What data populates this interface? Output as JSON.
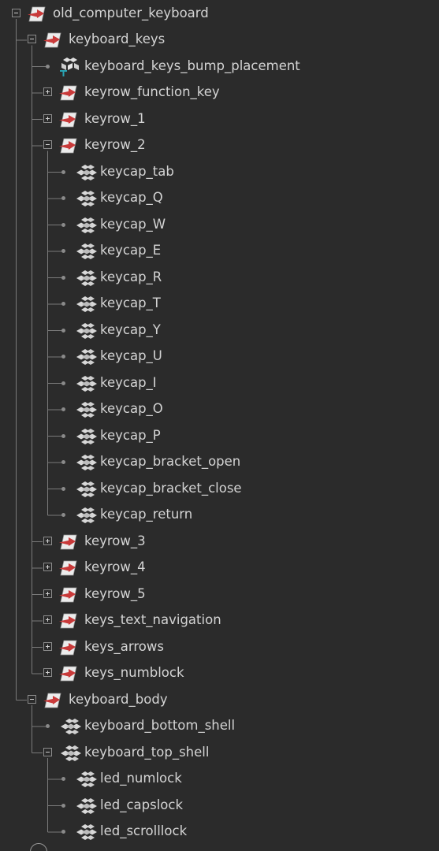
{
  "outliner": {
    "rows": [
      {
        "id": "old_computer_keyboard",
        "depth": 0,
        "state": "expanded",
        "icon": "transform-group-icon",
        "label": "old_computer_keyboard"
      },
      {
        "id": "keyboard_keys",
        "depth": 1,
        "state": "expanded",
        "icon": "transform-group-icon",
        "label": "keyboard_keys"
      },
      {
        "id": "keyboard_keys_bump_placement",
        "depth": 2,
        "state": "leaf",
        "icon": "texture-placement-icon",
        "label": "keyboard_keys_bump_placement"
      },
      {
        "id": "keyrow_function_key",
        "depth": 2,
        "state": "collapsed",
        "icon": "transform-group-icon",
        "label": "keyrow_function_key"
      },
      {
        "id": "keyrow_1",
        "depth": 2,
        "state": "collapsed",
        "icon": "transform-group-icon",
        "label": "keyrow_1"
      },
      {
        "id": "keyrow_2",
        "depth": 2,
        "state": "expanded",
        "icon": "transform-group-icon",
        "label": "keyrow_2"
      },
      {
        "id": "keycap_tab",
        "depth": 3,
        "state": "leaf",
        "icon": "mesh-icon",
        "label": "keycap_tab"
      },
      {
        "id": "keycap_Q",
        "depth": 3,
        "state": "leaf",
        "icon": "mesh-icon",
        "label": "keycap_Q"
      },
      {
        "id": "keycap_W",
        "depth": 3,
        "state": "leaf",
        "icon": "mesh-icon",
        "label": "keycap_W"
      },
      {
        "id": "keycap_E",
        "depth": 3,
        "state": "leaf",
        "icon": "mesh-icon",
        "label": "keycap_E"
      },
      {
        "id": "keycap_R",
        "depth": 3,
        "state": "leaf",
        "icon": "mesh-icon",
        "label": "keycap_R"
      },
      {
        "id": "keycap_T",
        "depth": 3,
        "state": "leaf",
        "icon": "mesh-icon",
        "label": "keycap_T"
      },
      {
        "id": "keycap_Y",
        "depth": 3,
        "state": "leaf",
        "icon": "mesh-icon",
        "label": "keycap_Y"
      },
      {
        "id": "keycap_U",
        "depth": 3,
        "state": "leaf",
        "icon": "mesh-icon",
        "label": "keycap_U"
      },
      {
        "id": "keycap_I",
        "depth": 3,
        "state": "leaf",
        "icon": "mesh-icon",
        "label": "keycap_I"
      },
      {
        "id": "keycap_O",
        "depth": 3,
        "state": "leaf",
        "icon": "mesh-icon",
        "label": "keycap_O"
      },
      {
        "id": "keycap_P",
        "depth": 3,
        "state": "leaf",
        "icon": "mesh-icon",
        "label": "keycap_P"
      },
      {
        "id": "keycap_bracket_open",
        "depth": 3,
        "state": "leaf",
        "icon": "mesh-icon",
        "label": "keycap_bracket_open"
      },
      {
        "id": "keycap_bracket_close",
        "depth": 3,
        "state": "leaf",
        "icon": "mesh-icon",
        "label": "keycap_bracket_close"
      },
      {
        "id": "keycap_return",
        "depth": 3,
        "state": "leaf",
        "icon": "mesh-icon",
        "label": "keycap_return"
      },
      {
        "id": "keyrow_3",
        "depth": 2,
        "state": "collapsed",
        "icon": "transform-group-icon",
        "label": "keyrow_3"
      },
      {
        "id": "keyrow_4",
        "depth": 2,
        "state": "collapsed",
        "icon": "transform-group-icon",
        "label": "keyrow_4"
      },
      {
        "id": "keyrow_5",
        "depth": 2,
        "state": "collapsed",
        "icon": "transform-group-icon",
        "label": "keyrow_5"
      },
      {
        "id": "keys_text_navigation",
        "depth": 2,
        "state": "collapsed",
        "icon": "transform-group-icon",
        "label": "keys_text_navigation"
      },
      {
        "id": "keys_arrows",
        "depth": 2,
        "state": "collapsed",
        "icon": "transform-group-icon",
        "label": "keys_arrows"
      },
      {
        "id": "keys_numblock",
        "depth": 2,
        "state": "collapsed",
        "icon": "transform-group-icon",
        "label": "keys_numblock"
      },
      {
        "id": "keyboard_body",
        "depth": 1,
        "state": "expanded",
        "icon": "transform-group-icon",
        "label": "keyboard_body"
      },
      {
        "id": "keyboard_bottom_shell",
        "depth": 2,
        "state": "leaf",
        "icon": "mesh-icon",
        "label": "keyboard_bottom_shell"
      },
      {
        "id": "keyboard_top_shell",
        "depth": 2,
        "state": "expanded",
        "icon": "mesh-icon",
        "label": "keyboard_top_shell"
      },
      {
        "id": "led_numlock",
        "depth": 3,
        "state": "leaf",
        "icon": "mesh-icon",
        "label": "led_numlock"
      },
      {
        "id": "led_capslock",
        "depth": 3,
        "state": "leaf",
        "icon": "mesh-icon",
        "label": "led_capslock"
      },
      {
        "id": "led_scrolllock",
        "depth": 3,
        "state": "leaf",
        "icon": "mesh-icon",
        "label": "led_scrolllock"
      }
    ]
  },
  "colors": {
    "background": "#2b2b2b",
    "text": "#d4d4d4",
    "tree_lines": "#7a7a7a",
    "group_icon_red": "#c93a3a",
    "mesh_icon": "#d8d8d8",
    "placement_icon_teal": "#2aa3b3"
  }
}
